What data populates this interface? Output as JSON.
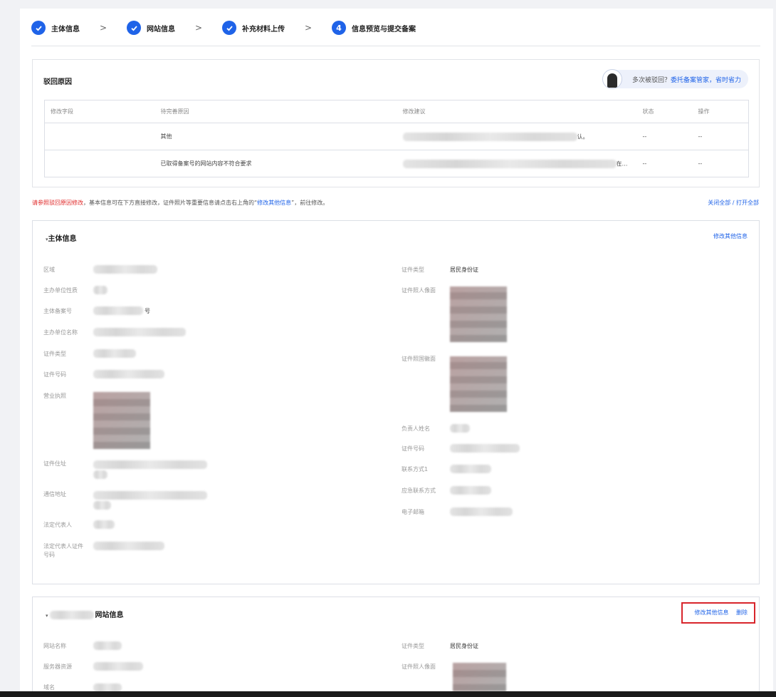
{
  "steps": [
    {
      "icon": "check",
      "label": "主体信息"
    },
    {
      "icon": "check",
      "label": "网站信息"
    },
    {
      "icon": "check",
      "label": "补充材料上传"
    },
    {
      "icon": "4",
      "label": "信息预览与提交备案"
    }
  ],
  "step_separator": ">",
  "reject": {
    "title": "驳回原因",
    "helper_text": "多次被驳回？",
    "helper_link": "委托备案管家，省时省力",
    "columns": [
      "修改字段",
      "待完善原因",
      "修改建议",
      "状态",
      "操作"
    ],
    "rows": [
      {
        "field": "",
        "reason": "其他",
        "suggestion_visible": "认。",
        "status": "--",
        "action": "--"
      },
      {
        "field": "",
        "reason": "已取得备案号的网站内容不符合要求",
        "suggestion_visible": "在…",
        "status": "--",
        "action": "--"
      }
    ]
  },
  "notice": {
    "part1": "请参照驳回原因修改",
    "part2": "，基本信息可在下方直接修改，证件照片等重要信息请点击右上角的“",
    "link": "修改其他信息",
    "part3": "”，前往修改。"
  },
  "toggle_all": "关闭全部 / 打开全部",
  "subject": {
    "title": "主体信息",
    "action": "修改其他信息",
    "left_fields": [
      {
        "label": "区域",
        "value": ""
      },
      {
        "label": "主办单位性质",
        "value": ""
      },
      {
        "label": "主体备案号",
        "value": "号"
      },
      {
        "label": "主办单位名称",
        "value": ""
      },
      {
        "label": "证件类型",
        "value": ""
      },
      {
        "label": "证件号码",
        "value": ""
      },
      {
        "label": "营业执照",
        "value": ""
      },
      {
        "label": "证件住址",
        "value": ""
      },
      {
        "label": "通信地址",
        "value": ""
      },
      {
        "label": "法定代表人",
        "value": ""
      },
      {
        "label": "法定代表人证件号码",
        "value": ""
      }
    ],
    "right_fields": [
      {
        "label": "证件类型",
        "value": "居民身份证"
      },
      {
        "label": "证件照人像面",
        "value": ""
      },
      {
        "label": "证件照国徽面",
        "value": ""
      },
      {
        "label": "负责人姓名",
        "value": ""
      },
      {
        "label": "证件号码",
        "value": ""
      },
      {
        "label": "联系方式1",
        "value": ""
      },
      {
        "label": "应急联系方式",
        "value": ""
      },
      {
        "label": "电子邮箱",
        "value": ""
      }
    ]
  },
  "website": {
    "title_suffix": "网站信息",
    "action_edit": "修改其他信息",
    "action_delete": "删除",
    "left_fields": [
      {
        "label": "网站名称",
        "value": ""
      },
      {
        "label": "服务器资源",
        "value": ""
      },
      {
        "label": "域名",
        "value": ""
      }
    ],
    "right_fields": [
      {
        "label": "证件类型",
        "value": "居民身份证"
      },
      {
        "label": "证件照人像面",
        "value": ""
      }
    ]
  },
  "colors": {
    "primary": "#1f63e8",
    "warning": "#e02b2b",
    "highlight_box": "#d8252b"
  }
}
